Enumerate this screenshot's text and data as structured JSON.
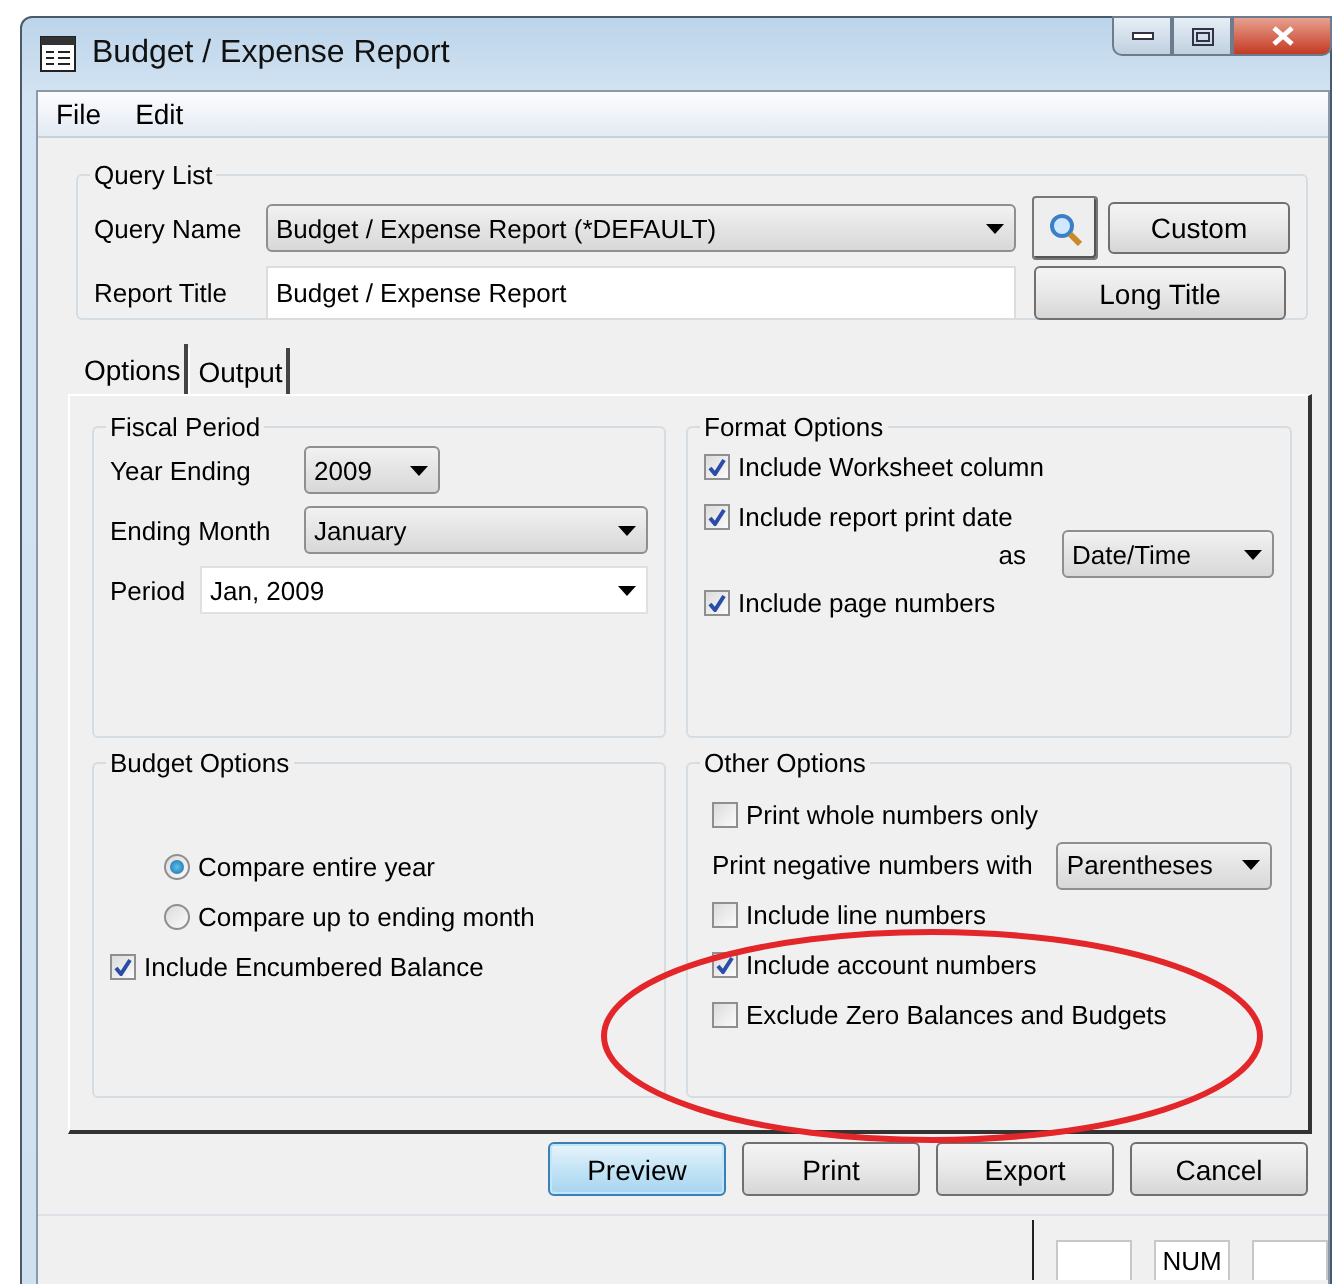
{
  "window": {
    "title": "Budget / Expense Report"
  },
  "menu": [
    "File",
    "Edit"
  ],
  "query_list": {
    "title": "Query List",
    "query_name": {
      "label": "Query Name",
      "value": "Budget / Expense Report (*DEFAULT)"
    },
    "report_title": {
      "label": "Report Title",
      "value": "Budget / Expense Report"
    },
    "buttons": [
      "Custom",
      "Long Title"
    ]
  },
  "tabs": [
    {
      "label": "Options",
      "selected": true
    },
    {
      "label": "Output",
      "selected": false
    }
  ],
  "fiscal_period": {
    "title": "Fiscal Period",
    "year_ending": {
      "label": "Year Ending",
      "value": "2009"
    },
    "ending_month": {
      "label": "Ending Month",
      "value": "January"
    },
    "period": {
      "label": "Period",
      "value": "Jan, 2009"
    }
  },
  "format_options": {
    "title": "Format Options",
    "items": [
      {
        "kind": "checkbox",
        "label": "Include Worksheet column",
        "checked": true
      },
      {
        "kind": "checkbox-select",
        "label": "Include report print date",
        "checked": true,
        "select_label": "as",
        "value": "Date/Time"
      },
      {
        "kind": "checkbox",
        "label": "Include page numbers",
        "checked": true
      }
    ]
  },
  "budget_options": {
    "title": "Budget Options",
    "items": [
      {
        "kind": "radio",
        "label": "Compare entire year",
        "selected": true
      },
      {
        "kind": "radio",
        "label": "Compare up to ending month",
        "selected": false
      },
      {
        "kind": "checkbox",
        "label": "Include Encumbered Balance",
        "checked": true
      }
    ]
  },
  "other_options": {
    "title": "Other Options",
    "items": [
      {
        "kind": "checkbox",
        "label": "Print whole numbers only",
        "checked": false
      },
      {
        "kind": "select",
        "label": "Print negative numbers with",
        "value": "Parentheses"
      },
      {
        "kind": "checkbox",
        "label": "Include line numbers",
        "checked": false
      },
      {
        "kind": "checkbox",
        "label": "Include account numbers",
        "checked": true
      },
      {
        "kind": "checkbox",
        "label": "Exclude Zero Balances and Budgets",
        "checked": false
      }
    ]
  },
  "buttons": [
    {
      "label": "Preview",
      "default": true
    },
    {
      "label": "Print",
      "default": false
    },
    {
      "label": "Export",
      "default": false
    },
    {
      "label": "Cancel",
      "default": false
    }
  ],
  "status_bar": {
    "indicator": "NUM"
  },
  "annotations": [
    {
      "kind": "ellipse"
    }
  ]
}
